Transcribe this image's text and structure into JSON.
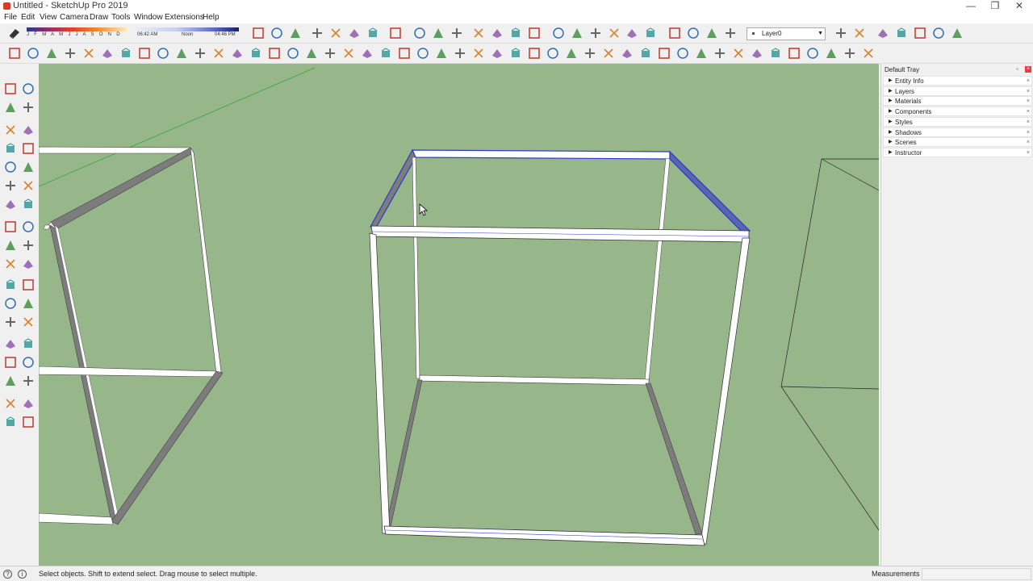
{
  "window": {
    "title": "Untitled - SketchUp Pro 2019",
    "controls": {
      "minimize": "—",
      "restore": "❐",
      "close": "✕"
    }
  },
  "menu": [
    "File",
    "Edit",
    "View",
    "Camera",
    "Draw",
    "Tools",
    "Window",
    "Extensions",
    "Help"
  ],
  "shadow_settings": {
    "months_label": "J F M A M J J A S O N D",
    "time_start": "06:42 AM",
    "time_mid": "Noon",
    "time_end": "04:46 PM"
  },
  "layer": {
    "current": "Layer0"
  },
  "tray": {
    "title": "Default Tray",
    "panels": [
      {
        "label": "Entity Info"
      },
      {
        "label": "Layers"
      },
      {
        "label": "Materials"
      },
      {
        "label": "Components"
      },
      {
        "label": "Styles"
      },
      {
        "label": "Shadows"
      },
      {
        "label": "Scenes"
      },
      {
        "label": "Instructor"
      }
    ]
  },
  "status": {
    "hint": "Select objects. Shift to extend select. Drag mouse to select multiple.",
    "measurements_label": "Measurements",
    "measurements_value": ""
  },
  "colors": {
    "viewport_bg": "#97b78b",
    "selection_blue": "#2b3ad0",
    "beam_white": "#ffffff",
    "beam_shadow": "#7c7c7c",
    "axis_green": "#2fa83a"
  },
  "icons": {
    "top_row_1": [
      "eraser-icon",
      "shadow-toggle-icon",
      "fog-icon",
      "section-plane-icon",
      "move-icon",
      "text-icon",
      "paint-icon",
      "wireframe-icon",
      "xray-icon",
      "hidden-line-icon",
      "shaded-icon",
      "shaded-textures-icon",
      "monochrome-icon",
      "iso-view-icon",
      "top-view-icon",
      "front-view-icon",
      "right-view-icon",
      "back-view-icon",
      "left-view-icon",
      "warehouse-icon",
      "extension-icon",
      "layout-icon"
    ],
    "left_tools": [
      "select-icon",
      "make-component-icon",
      "paint-bucket-icon",
      "eraser-icon",
      "line-icon",
      "freehand-icon",
      "rectangle-icon",
      "rotated-rectangle-icon",
      "circle-icon",
      "polygon-icon",
      "arc-icon",
      "pie-icon",
      "move-icon",
      "push-pull-icon",
      "rotate-icon",
      "follow-me-icon",
      "scale-icon",
      "offset-icon",
      "tape-measure-icon",
      "dimension-icon",
      "protractor-icon",
      "text-icon",
      "axes-icon",
      "3d-text-icon",
      "orbit-icon",
      "pan-icon",
      "zoom-icon",
      "zoom-window-icon",
      "zoom-extents-icon",
      "previous-icon",
      "position-camera-icon",
      "look-around-icon",
      "walk-icon",
      "section-icon"
    ]
  }
}
